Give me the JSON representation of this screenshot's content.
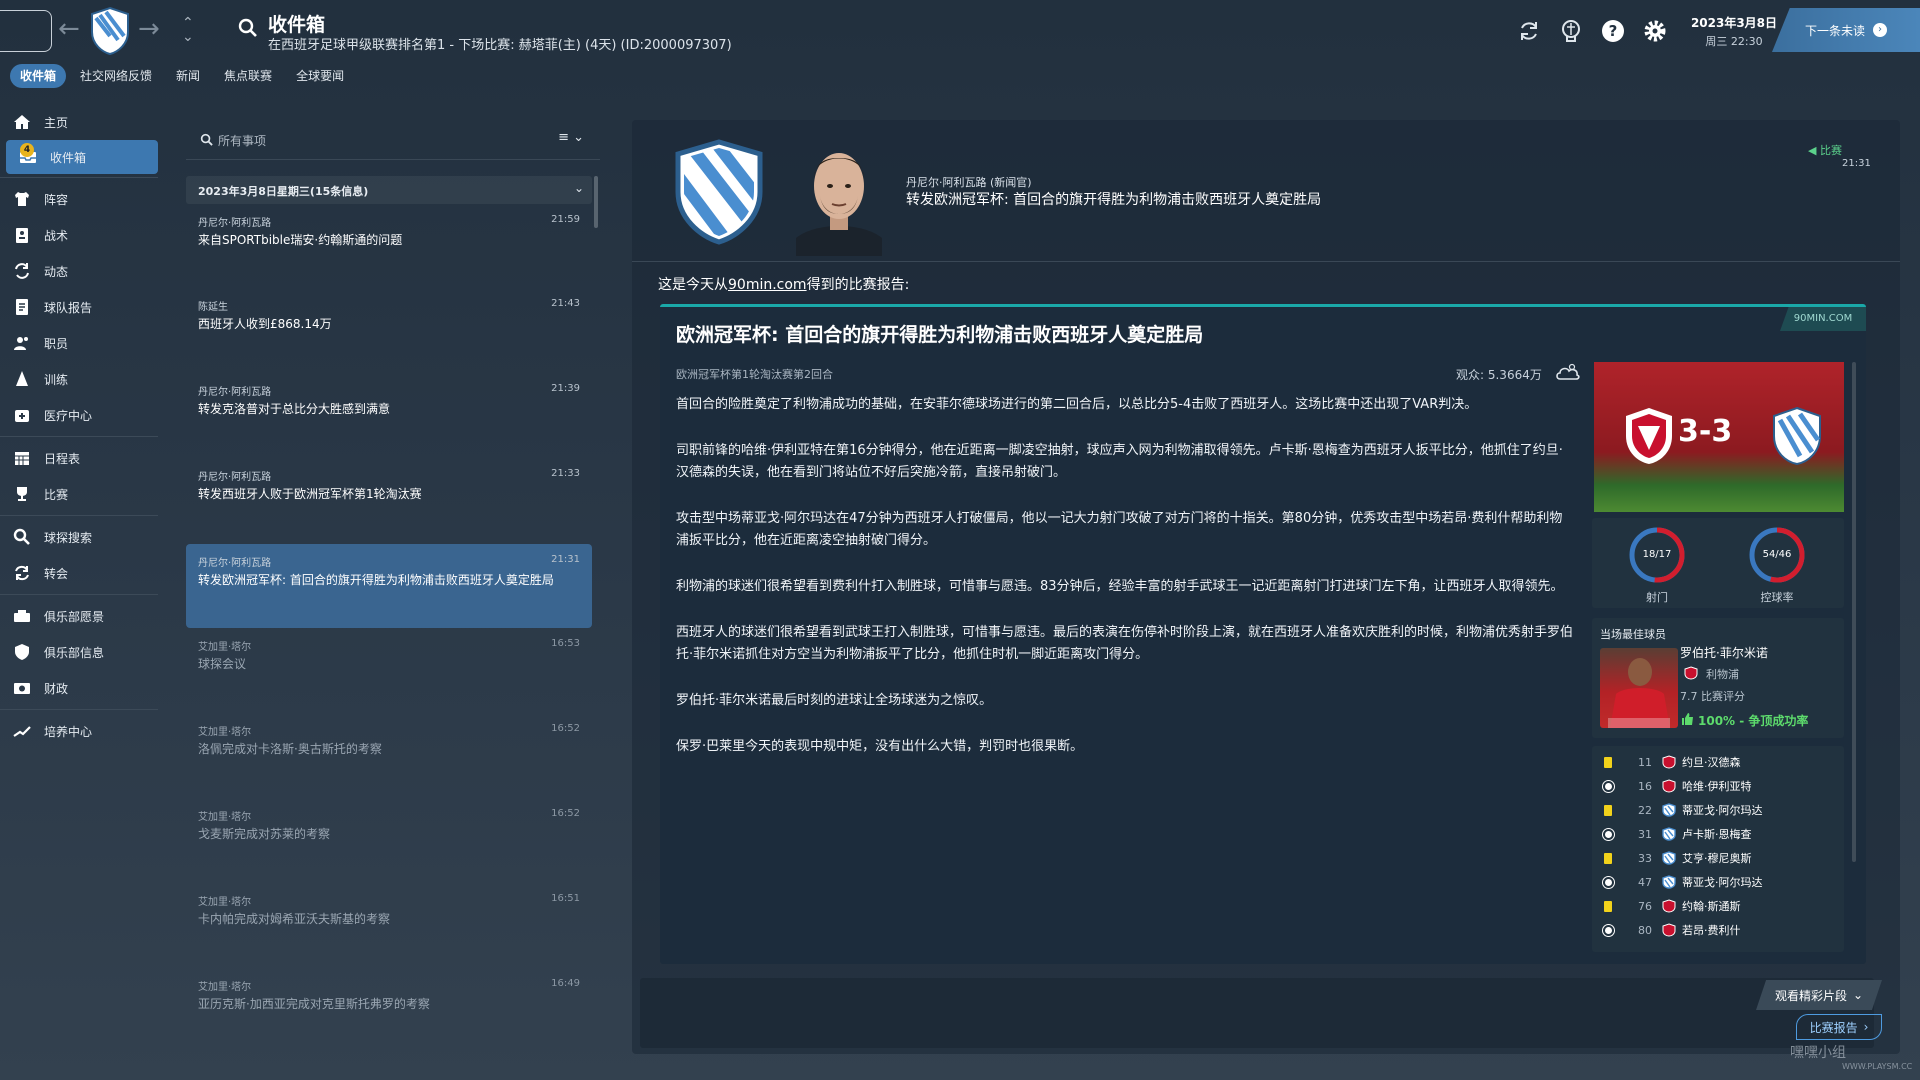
{
  "topbar": {
    "title": "收件箱",
    "subtitle": "在西班牙足球甲级联赛排名第1 - 下场比赛: 赫塔菲(主) (4天) (ID:2000097307)",
    "date_line1": "2023年3月8日",
    "date_line2": "周三 22:30",
    "next_unread": "下一条未读",
    "icons": [
      "refresh-icon",
      "brain-icon",
      "help-icon",
      "gear-icon"
    ]
  },
  "tabs": [
    {
      "label": "收件箱",
      "active": true
    },
    {
      "label": "社交网络反馈"
    },
    {
      "label": "新闻"
    },
    {
      "label": "焦点联赛"
    },
    {
      "label": "全球要闻"
    }
  ],
  "sidebar": {
    "badge": "4",
    "items": [
      {
        "label": "主页",
        "icon": "home-icon"
      },
      {
        "label": "收件箱",
        "icon": "inbox-icon",
        "active": true
      },
      {
        "label": "阵容",
        "icon": "jersey-icon"
      },
      {
        "label": "战术",
        "icon": "tactics-icon"
      },
      {
        "label": "动态",
        "icon": "dynamics-icon"
      },
      {
        "label": "球队报告",
        "icon": "report-icon"
      },
      {
        "label": "职员",
        "icon": "staff-icon"
      },
      {
        "label": "训练",
        "icon": "training-icon"
      },
      {
        "label": "医疗中心",
        "icon": "medical-icon"
      },
      {
        "label": "日程表",
        "icon": "calendar-icon"
      },
      {
        "label": "比赛",
        "icon": "trophy-icon"
      },
      {
        "label": "球探搜索",
        "icon": "scout-icon"
      },
      {
        "label": "转会",
        "icon": "transfer-icon"
      },
      {
        "label": "俱乐部愿景",
        "icon": "vision-icon"
      },
      {
        "label": "俱乐部信息",
        "icon": "shield-icon"
      },
      {
        "label": "财政",
        "icon": "finance-icon"
      },
      {
        "label": "培养中心",
        "icon": "development-icon"
      }
    ]
  },
  "inbox": {
    "search_placeholder": "所有事项",
    "filter_label": "≡ ⌄",
    "group_label": "2023年3月8日星期三(15条信息)",
    "messages": [
      {
        "sender": "丹尼尔·阿利瓦路",
        "time": "21:59",
        "subject": "来自SPORTbible瑞安·约翰斯通的问题"
      },
      {
        "sender": "陈延生",
        "time": "21:43",
        "subject": "西班牙人收到£868.14万"
      },
      {
        "sender": "丹尼尔·阿利瓦路",
        "time": "21:39",
        "subject": "转发克洛普对于总比分大胜感到满意"
      },
      {
        "sender": "丹尼尔·阿利瓦路",
        "time": "21:33",
        "subject": "转发西班牙人败于欧洲冠军杯第1轮淘汰赛"
      },
      {
        "sender": "丹尼尔·阿利瓦路",
        "time": "21:31",
        "subject": "转发欧洲冠军杯: 首回合的旗开得胜为利物浦击败西班牙人奠定胜局",
        "selected": true
      },
      {
        "sender": "艾加里·塔尔",
        "time": "16:53",
        "subject": "球探会议",
        "dim": true
      },
      {
        "sender": "艾加里·塔尔",
        "time": "16:52",
        "subject": "洛佩完成对卡洛斯·奥古斯托的考察",
        "dim": true
      },
      {
        "sender": "艾加里·塔尔",
        "time": "16:52",
        "subject": "戈麦斯完成对苏莱的考察",
        "dim": true
      },
      {
        "sender": "艾加里·塔尔",
        "time": "16:51",
        "subject": "卡内帕完成对姆希亚沃夫斯基的考察",
        "dim": true
      },
      {
        "sender": "艾加里·塔尔",
        "time": "16:49",
        "subject": "亚历克斯·加西亚完成对克里斯托弗罗的考察",
        "dim": true
      }
    ]
  },
  "message": {
    "author": "丹尼尔·阿利瓦路 (新闻官)",
    "headline": "转发欧洲冠军杯: 首回合的旗开得胜为利物浦击败西班牙人奠定胜局",
    "tag": "比赛",
    "tag_time": "21:31",
    "intro_prefix": "这是今天从",
    "intro_link": "90min.com",
    "intro_suffix": "得到的比赛报告:"
  },
  "article": {
    "source": "90MIN.COM",
    "title": "欧洲冠军杯: 首回合的旗开得胜为利物浦击败西班牙人奠定胜局",
    "subtitle": "欧洲冠军杯第1轮淘汰赛第2回合",
    "attendance": "观众: 5.3664万",
    "paragraphs": [
      "首回合的险胜奠定了利物浦成功的基础，在安菲尔德球场进行的第二回合后，以总比分5-4击败了西班牙人。这场比赛中还出现了VAR判决。",
      "司职前锋的哈维·伊利亚特在第16分钟得分，他在近距离一脚凌空抽射，球应声入网为利物浦取得领先。卢卡斯·恩梅查为西班牙人扳平比分，他抓住了约旦·汉德森的失误，他在看到门将站位不好后突施冷箭，直接吊射破门。",
      "攻击型中场蒂亚戈·阿尔玛达在47分钟为西班牙人打破僵局，他以一记大力射门攻破了对方门将的十指关。第80分钟，优秀攻击型中场若昂·费利什帮助利物浦扳平比分，他在近距离凌空抽射破门得分。",
      "利物浦的球迷们很希望看到费利什打入制胜球，可惜事与愿违。83分钟后，经验丰富的射手武球王一记近距离射门打进球门左下角，让西班牙人取得领先。",
      "西班牙人的球迷们很希望看到武球王打入制胜球，可惜事与愿违。最后的表演在伤停补时阶段上演，就在西班牙人准备欢庆胜利的时候，利物浦优秀射手罗伯托·菲尔米诺抓住对方空当为利物浦扳平了比分，他抓住时机一脚近距离攻门得分。",
      "罗伯托·菲尔米诺最后时刻的进球让全场球迷为之惊叹。",
      "保罗·巴莱里今天的表现中规中矩，没有出什么大错，判罚时也很果断。"
    ]
  },
  "match": {
    "score": "3-3",
    "shots": "18/17",
    "shots_label": "射门",
    "possession": "54/46",
    "possession_label": "控球率",
    "possession_home": 0.54,
    "motm_title": "当场最佳球员",
    "motm_name": "罗伯托·菲尔米诺",
    "motm_team": "利物浦",
    "motm_rating": "7.7 比赛评分",
    "motm_success": "100% - 争顶成功率",
    "events": [
      {
        "type": "yellow",
        "minute": "11",
        "team": "home",
        "player": "约旦·汉德森"
      },
      {
        "type": "goal",
        "minute": "16",
        "team": "home",
        "player": "哈维·伊利亚特"
      },
      {
        "type": "yellow",
        "minute": "22",
        "team": "away",
        "player": "蒂亚戈·阿尔玛达"
      },
      {
        "type": "goal",
        "minute": "31",
        "team": "away",
        "player": "卢卡斯·恩梅查"
      },
      {
        "type": "yellow",
        "minute": "33",
        "team": "away",
        "player": "艾亨·穆尼奥斯"
      },
      {
        "type": "goal",
        "minute": "47",
        "team": "away",
        "player": "蒂亚戈·阿尔玛达"
      },
      {
        "type": "yellow",
        "minute": "76",
        "team": "home",
        "player": "约翰·斯通斯"
      },
      {
        "type": "goal",
        "minute": "80",
        "team": "home",
        "player": "若昂·费利什"
      }
    ]
  },
  "bottom": {
    "highlights": "观看精彩片段",
    "report": "比赛报告"
  },
  "watermark": "嘿嘿小组",
  "watermark_sub": "WWW.PLAYSM.CC",
  "colors": {
    "accent": "#3d78b0",
    "liverpool": "#c8102e",
    "espanyol": "#4a8ed0",
    "success": "#5ddb6c"
  }
}
